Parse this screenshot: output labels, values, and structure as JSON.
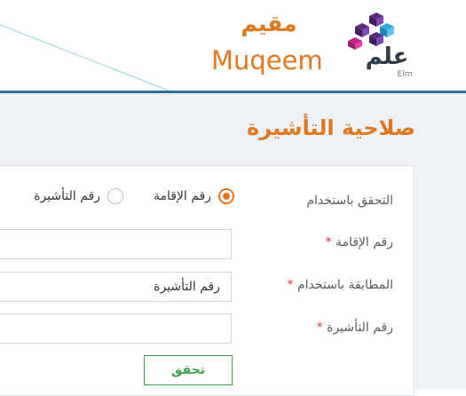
{
  "header": {
    "brand_ar": "مقيم",
    "brand_en": "Muqeem",
    "logo_ar": "علم",
    "logo_en": "Elm",
    "accent_color": "#e07822",
    "rule_color": "#2d6d9c"
  },
  "page": {
    "title": "صلاحية التأشيرة"
  },
  "form": {
    "verify_label": "التحقق باستخدام",
    "radio_options": [
      {
        "label": "رقم الإقامة",
        "selected": true
      },
      {
        "label": "رقم التأشيرة",
        "selected": false
      }
    ],
    "iqama_label": "رقم الإقامة",
    "iqama_value": "",
    "match_label": "المطابقة باستخدام",
    "match_selected": "رقم التأشيرة",
    "visa_label": "رقم التأشيرة",
    "visa_value": "",
    "required_mark": "*",
    "submit_label": "تحقق"
  }
}
